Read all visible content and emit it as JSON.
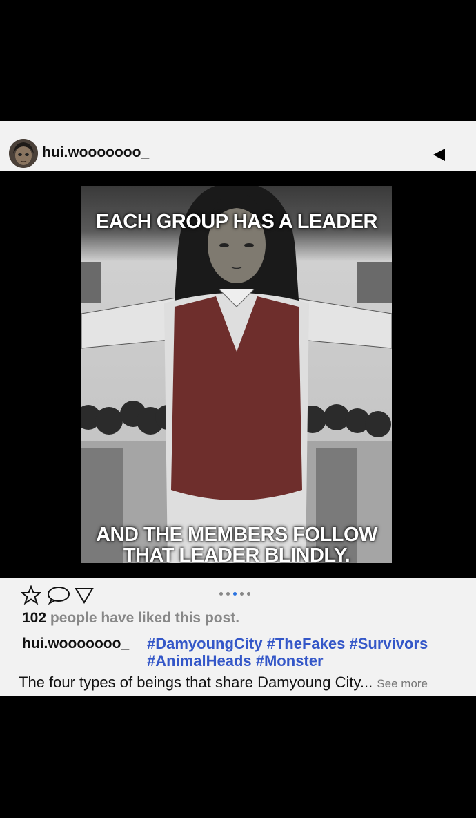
{
  "post": {
    "username": "hui.wooooooo_",
    "image": {
      "caption_top": "EACH GROUP HAS A LEADER",
      "caption_bottom_line1": "AND THE MEMBERS FOLLOW",
      "caption_bottom_line2": "THAT LEADER BLINDLY."
    },
    "carousel": {
      "count": 5,
      "active": 3
    },
    "likes_count": "102",
    "likes_text": " people have liked this post.",
    "caption_username": "hui.wooooooo_",
    "hashtags": [
      "#DamyoungCity",
      "#TheFakes",
      "#Survivors",
      "#AnimalHeads",
      "#Monster"
    ],
    "description": "The four types of beings that share Damyoung City...",
    "see_more": "See more"
  },
  "icons": [
    "avatar",
    "back-arrow-icon",
    "star-icon",
    "comment-icon",
    "share-icon"
  ],
  "colors": {
    "hashtag": "#3457c8",
    "active_dot": "#2a73e0",
    "muted": "#888888",
    "background": "#000000",
    "post_bg": "#f2f2f2"
  }
}
